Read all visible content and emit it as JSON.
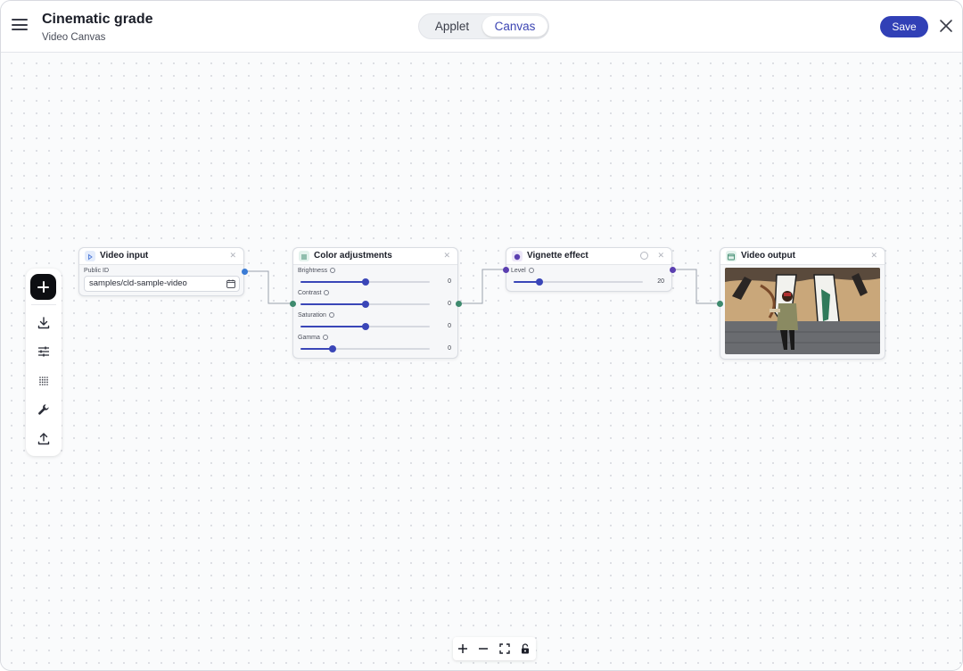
{
  "header": {
    "title": "Cinematic grade",
    "subtitle": "Video Canvas",
    "tabs": [
      {
        "label": "Applet",
        "active": false
      },
      {
        "label": "Canvas",
        "active": true
      }
    ],
    "save_label": "Save"
  },
  "toolbar": {
    "items": [
      "add-icon",
      "download-icon",
      "sliders-icon",
      "grid-icon",
      "wrench-icon",
      "upload-icon"
    ]
  },
  "nodes": {
    "video_input": {
      "title": "Video input",
      "public_id_label": "Public ID",
      "public_id_value": "samples/cld-sample-video"
    },
    "color_adjustments": {
      "title": "Color adjustments",
      "sliders": [
        {
          "label": "Brightness",
          "value": "0",
          "level": 0.5
        },
        {
          "label": "Contrast",
          "value": "0",
          "level": 0.5
        },
        {
          "label": "Saturation",
          "value": "0",
          "level": 0.5
        },
        {
          "label": "Gamma",
          "value": "0",
          "level": 0.25
        }
      ]
    },
    "vignette_effect": {
      "title": "Vignette effect",
      "sliders": [
        {
          "label": "Level",
          "value": "20",
          "level": 0.2
        }
      ]
    },
    "video_output": {
      "title": "Video output"
    }
  },
  "colors": {
    "accent": "#3140b6",
    "slider": "#3a46b8",
    "handle_blue": "#3a7bd5",
    "handle_green": "#3e8a6e",
    "handle_purple": "#5b3fb0"
  }
}
